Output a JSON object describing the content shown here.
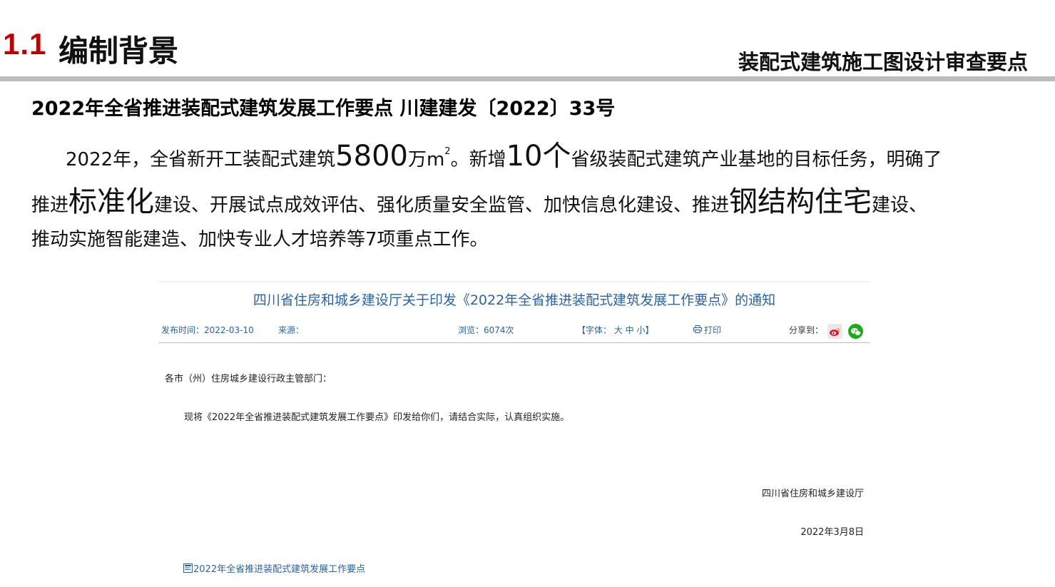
{
  "header": {
    "section_number": "1.1",
    "section_title": "编制背景",
    "course_title": "装配式建筑施工图设计审查要点"
  },
  "doc_heading": "2022年全省推进装配式建筑发展工作要点 川建建发〔2022〕33号",
  "paragraph": {
    "l1_a": "2022年，全省新开工装配式建筑",
    "l1_big1": "5800",
    "l1_b": "万m",
    "l1_sup": "2",
    "l1_c": "。新增",
    "l1_big2": "10个",
    "l1_d": "省级装配式建筑产业基地的目标任务，明确了",
    "l2_a": "推进",
    "l2_big1": "标准化",
    "l2_b": "建设、开展试点成效评估、强化质量安全监管、加快信息化建设、推进",
    "l2_big2": "钢结构住宅",
    "l2_c": "建设、",
    "l3": "推动实施智能建造、加快专业人才培养等7项重点工作。"
  },
  "notice": {
    "title": "四川省住房和城乡建设厅关于印发《2022年全省推进装配式建筑发展工作要点》的通知",
    "publish_time": "发布时间：2022-03-10",
    "source": "来源：",
    "views": "浏览：6074次",
    "font_size": "【字体： 大 中 小】",
    "print": "打印",
    "share_to": "分享到：",
    "addressee": "各市（州）住房城乡建设行政主管部门：",
    "body": "现将《2022年全省推进装配式建筑发展工作要点》印发给你们，请结合实际，认真组织实施。",
    "signer": "四川省住房和城乡建设厅",
    "sign_date": "2022年3月8日",
    "attachment": "2022年全省推进装配式建筑发展工作要点"
  },
  "colors": {
    "accent_red": "#c00000",
    "link_blue": "#2a63a8",
    "rule_gray": "#bdbdbd",
    "wechat_green": "#1aad19",
    "weibo_red": "#e6162d"
  },
  "icons": {
    "print": "printer-icon",
    "weibo": "weibo-icon",
    "wechat": "wechat-icon",
    "attachment": "document-icon"
  }
}
